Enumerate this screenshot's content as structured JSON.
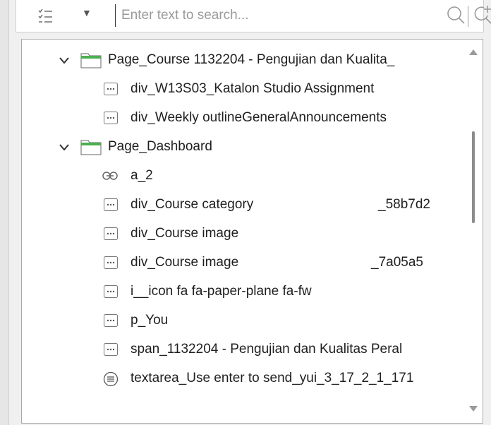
{
  "search": {
    "placeholder": "Enter text to search..."
  },
  "icons": {
    "filter": "filter-list-icon",
    "dropdown": "chevron-down-icon",
    "search": "search-icon",
    "add_search": "add-search-icon",
    "folder": "folder-icon",
    "element": "element-icon",
    "link": "link-icon",
    "textarea": "textarea-icon"
  },
  "colors": {
    "folder_fill": "#4caf50",
    "scroll_thumb": "#8c8c8c"
  },
  "tree": {
    "rows": [
      {
        "label": "Page_Course 1132204 - Pengujian dan Kualita_",
        "kind": "folder",
        "expanded": true
      },
      {
        "label": "div_W13S03_Katalon Studio Assignment",
        "kind": "element"
      },
      {
        "label": "div_Weekly outlineGeneralAnnouncements",
        "kind": "element"
      },
      {
        "label": "Page_Dashboard",
        "kind": "folder",
        "expanded": true
      },
      {
        "label": "a_2",
        "kind": "link"
      },
      {
        "label": "div_Course category",
        "suffix": "_58b7d2",
        "kind": "element"
      },
      {
        "label": "div_Course image",
        "kind": "element"
      },
      {
        "label": "div_Course image",
        "suffix": "_7a05a5",
        "kind": "element"
      },
      {
        "label": "i__icon fa fa-paper-plane fa-fw",
        "kind": "element"
      },
      {
        "label": "p_You",
        "kind": "element"
      },
      {
        "label": "span_1132204 - Pengujian dan Kualitas Peral",
        "kind": "element"
      },
      {
        "label": "textarea_Use enter to send_yui_3_17_2_1_171",
        "kind": "textarea"
      }
    ]
  }
}
